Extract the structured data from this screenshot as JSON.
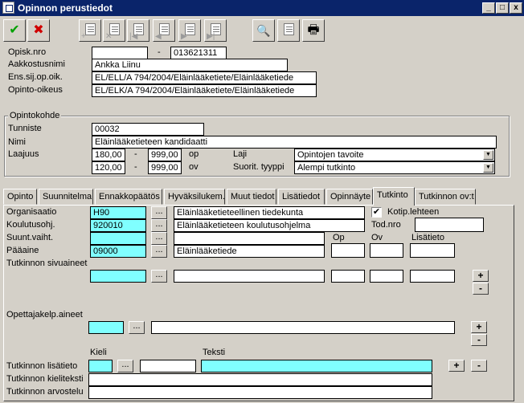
{
  "window": {
    "title": "Opinnon perustiedot",
    "controls": {
      "minimize": "_",
      "maximize": "□",
      "close": "x"
    }
  },
  "toolbar": {
    "accept": "✔",
    "cancel": "✖",
    "search": "🔍",
    "print": "🖶"
  },
  "header": {
    "opisknro_label": "Opisk.nro",
    "opisknro_value": "",
    "dash": "-",
    "opisknro_value2": "013621311",
    "aakkostusnimi_label": "Aakkostusnimi",
    "aakkostusnimi_value": "Ankka Liinu",
    "enssij_label": "Ens.sij.op.oik.",
    "enssij_value": "EL/ELL/A 794/2004/Eläinlääketiete/Eläinlääketiede",
    "opintooikeus_label": "Opinto-oikeus",
    "opintooikeus_value": "EL/ELK/A 794/2004/Eläinlääketiete/Eläinlääketiede"
  },
  "opintokohde": {
    "group_label": "Opintokohde",
    "tunniste_label": "Tunniste",
    "tunniste_value": "00032",
    "nimi_label": "Nimi",
    "nimi_value": "Eläinlääketieteen kandidaatti",
    "laajuus_label": "Laajuus",
    "laajuus_op_min": "180,00",
    "laajuus_op_max": "999,00",
    "unit_op": "op",
    "laajuus_ov_min": "120,00",
    "laajuus_ov_max": "999,00",
    "unit_ov": "ov",
    "dash": "-",
    "laji_label": "Laji",
    "laji_value": "Opintojen tavoite",
    "suorit_label": "Suorit. tyyppi",
    "suorit_value": "Alempi tutkinto"
  },
  "tabs": [
    {
      "label": "Opinto"
    },
    {
      "label": "Suunnitelma"
    },
    {
      "label": "Ennakkopäätös"
    },
    {
      "label": "Hyväksilukem."
    },
    {
      "label": "Muut tiedot"
    },
    {
      "label": "Lisätiedot"
    },
    {
      "label": "Opinnäyte"
    },
    {
      "label": "Tutkinto"
    },
    {
      "label": "Tutkinnon ov:t"
    }
  ],
  "tutkinto": {
    "organisaatio_label": "Organisaatio",
    "organisaatio_code": "H90",
    "organisaatio_name": "Eläinlääketieteellinen tiedekunta",
    "kotip_label": "Kotip.lehteen",
    "kotip_check": "✔",
    "koulutus_label": "Koulutusohj.",
    "koulutus_code": "920010",
    "koulutus_name": "Eläinlääketieteen koulutusohjelma",
    "todnro_label": "Tod.nro",
    "todnro_value": "",
    "suunt_label": "Suunt.vaiht.",
    "col_op": "Op",
    "col_ov": "Ov",
    "col_lisatieto": "Lisätieto",
    "paaaine_label": "Pääaine",
    "paaaine_code": "09000",
    "paaaine_name": "Eläinlääketiede",
    "sivuaineet_label": "Tutkinnon sivuaineet",
    "opettaja_label": "Opettajakelp.aineet",
    "kieli_label": "Kieli",
    "teksti_label": "Teksti",
    "lisatieto_label": "Tutkinnon lisätieto",
    "kieliteksti_label": "Tutkinnon kieliteksti",
    "arvostelu_label": "Tutkinnon arvostelu",
    "dots": "...",
    "plus": "+",
    "minus": "-"
  }
}
